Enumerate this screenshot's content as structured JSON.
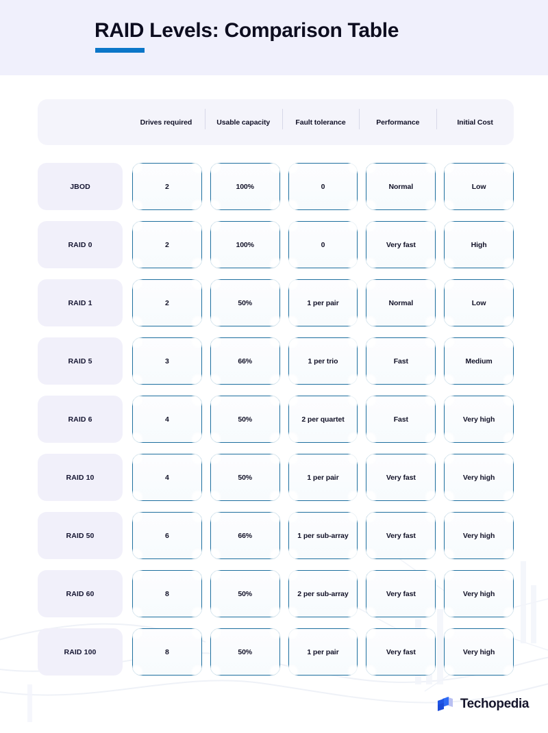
{
  "header": {
    "title": "RAID Levels: Comparison Table",
    "accent_color": "#0b76c8",
    "band_color": "#f0f0fc"
  },
  "table": {
    "row_label_header": "",
    "columns": [
      "Drives required",
      "Usable capacity",
      "Fault tolerance",
      "Performance",
      "Initial Cost"
    ],
    "rows": [
      {
        "label": "JBOD",
        "cells": [
          "2",
          "100%",
          "0",
          "Normal",
          "Low"
        ]
      },
      {
        "label": "RAID 0",
        "cells": [
          "2",
          "100%",
          "0",
          "Very fast",
          "High"
        ]
      },
      {
        "label": "RAID 1",
        "cells": [
          "2",
          "50%",
          "1 per pair",
          "Normal",
          "Low"
        ]
      },
      {
        "label": "RAID 5",
        "cells": [
          "3",
          "66%",
          "1 per trio",
          "Fast",
          "Medium"
        ]
      },
      {
        "label": "RAID 6",
        "cells": [
          "4",
          "50%",
          "2 per quartet",
          "Fast",
          "Very high"
        ]
      },
      {
        "label": "RAID 10",
        "cells": [
          "4",
          "50%",
          "1 per pair",
          "Very fast",
          "Very high"
        ]
      },
      {
        "label": "RAID 50",
        "cells": [
          "6",
          "66%",
          "1 per sub-array",
          "Very fast",
          "Very high"
        ]
      },
      {
        "label": "RAID 60",
        "cells": [
          "8",
          "50%",
          "2 per sub-array",
          "Very fast",
          "Very high"
        ]
      },
      {
        "label": "RAID 100",
        "cells": [
          "8",
          "50%",
          "1 per pair",
          "Very fast",
          "Very high"
        ]
      }
    ],
    "cell_border_color": "#1c6e9e",
    "row_label_bg": "#f1f0fa"
  },
  "footer": {
    "brand": "Techopedia",
    "logo_colors": {
      "primary": "#1b4bd8",
      "secondary": "#2f6bf5",
      "tertiary": "#b9c0f2"
    }
  }
}
